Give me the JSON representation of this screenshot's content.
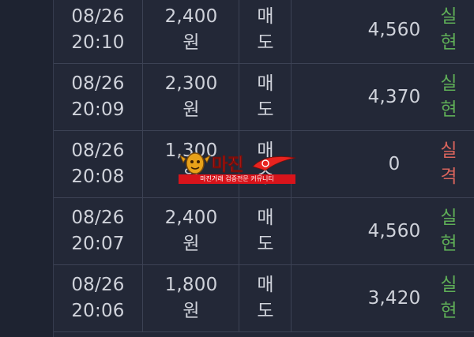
{
  "rows": [
    {
      "date": "08/26",
      "time": "20:10",
      "price": "2,400",
      "unit": "원",
      "side_1": "매",
      "side_2": "도",
      "amount": "4,560",
      "result_1": "실",
      "result_2": "현",
      "status": "win"
    },
    {
      "date": "08/26",
      "time": "20:09",
      "price": "2,300",
      "unit": "원",
      "side_1": "매",
      "side_2": "도",
      "amount": "4,370",
      "result_1": "실",
      "result_2": "현",
      "status": "win"
    },
    {
      "date": "08/26",
      "time": "20:08",
      "price": "1,300",
      "unit": "원",
      "side_1": "매",
      "side_2": "수",
      "amount": "0",
      "result_1": "실",
      "result_2": "격",
      "status": "loss"
    },
    {
      "date": "08/26",
      "time": "20:07",
      "price": "2,400",
      "unit": "원",
      "side_1": "매",
      "side_2": "도",
      "amount": "4,560",
      "result_1": "실",
      "result_2": "현",
      "status": "win"
    },
    {
      "date": "08/26",
      "time": "20:06",
      "price": "1,800",
      "unit": "원",
      "side_1": "매",
      "side_2": "도",
      "amount": "3,420",
      "result_1": "실",
      "result_2": "현",
      "status": "win"
    }
  ],
  "watermark": {
    "logo_text": "마진",
    "banner_text": "마진거래 검증전문 커뮤니티"
  },
  "colors": {
    "background": "#232837",
    "text": "#cfd2da",
    "win": "#5fae57",
    "loss": "#d9645c",
    "watermark_red": "#d8141b"
  }
}
